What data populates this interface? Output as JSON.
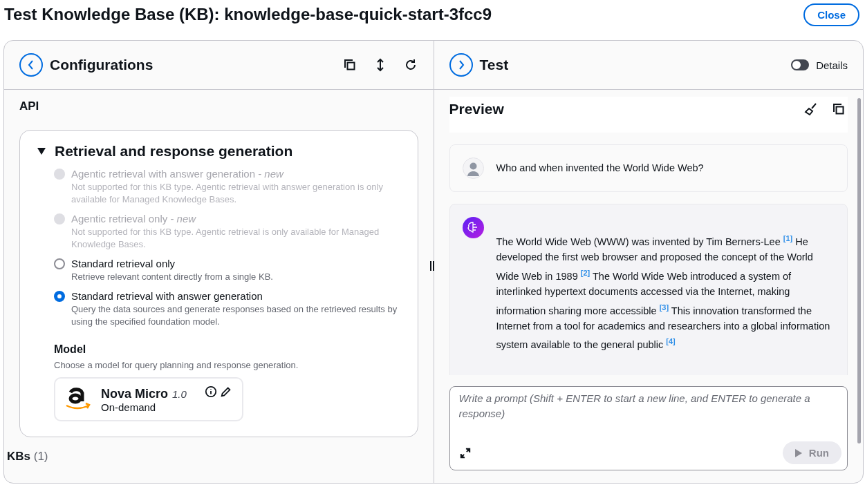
{
  "title": "Test Knowledge Base (KB): knowledge-base-quick-start-3fcc9",
  "close_button": "Close",
  "configurations": {
    "title": "Configurations",
    "api_label": "API",
    "section": {
      "title": "Retrieval and response generation",
      "expanded": true,
      "options": [
        {
          "label": "Agentic retrieval with answer generation - *new*",
          "description": "Not supported for this KB type. Agentic retrieval with answer generation is only available for Managed Knowledge Bases.",
          "disabled": true,
          "selected": false
        },
        {
          "label": "Agentic retrieval only - *new*",
          "description": "Not supported for this KB type. Agentic retrieval is only available for Managed Knowledge Bases.",
          "disabled": true,
          "selected": false
        },
        {
          "label": "Standard retrieval only",
          "description": "Retrieve relevant content directly from a single KB.",
          "disabled": false,
          "selected": false
        },
        {
          "label": "Standard retrieval with answer generation",
          "description": "Query the data sources and generate responses based on the retrieved results by using the specified foundation model.",
          "disabled": false,
          "selected": true
        }
      ],
      "model": {
        "label": "Model",
        "description": "Choose a model for query planning and response generation.",
        "name": "Nova Micro",
        "version": "1.0",
        "mode": "On-demand"
      }
    },
    "kbs_label": "KBs",
    "kbs_count": "(1)"
  },
  "test": {
    "title": "Test",
    "details_toggle": {
      "label": "Details",
      "on": false
    },
    "preview_title": "Preview",
    "messages": [
      {
        "kind": "user",
        "text": "Who and when invented the World Wide Web?"
      },
      {
        "kind": "assistant",
        "text": "The World Wide Web (WWW) was invented by Tim Berners-Lee $^{[1]}$ He developed the first web browser and proposed the concept of the World Wide Web in 1989 $^{[2]}$ The World Wide Web introduced a system of interlinked hypertext documents accessed via the Internet, making information sharing more accessible $^{[3]}$ This innovation transformed the Internet from a tool for academics and researchers into a global information system available to the general public $^{[4]}$"
      }
    ],
    "prompt": {
      "placeholder": "Write a prompt (Shift + ENTER to start a new line, and ENTER to generate a response)"
    },
    "run_button": {
      "label": "Run",
      "disabled": true
    }
  }
}
